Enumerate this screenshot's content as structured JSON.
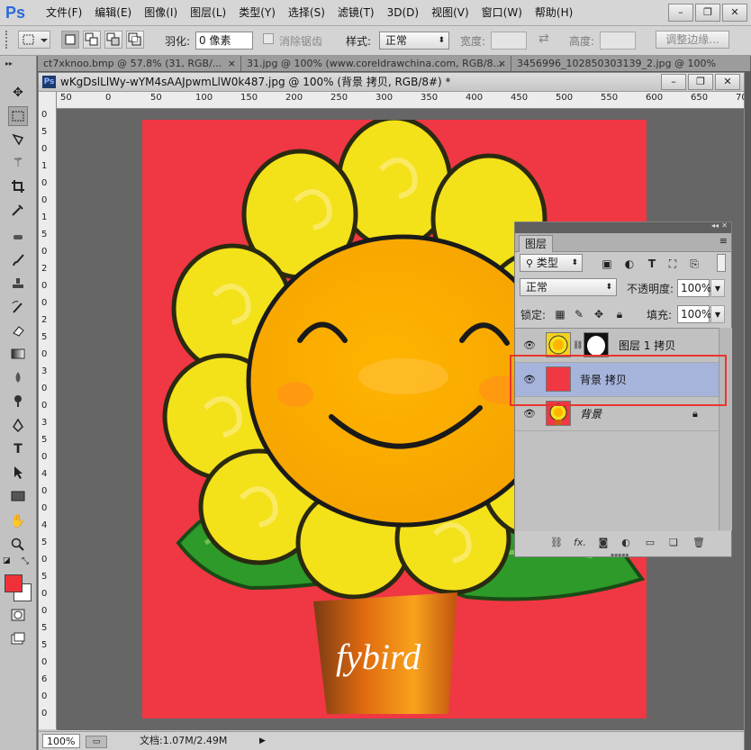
{
  "app": {
    "logo": "Ps"
  },
  "menu": [
    "文件(F)",
    "编辑(E)",
    "图像(I)",
    "图层(L)",
    "类型(Y)",
    "选择(S)",
    "滤镜(T)",
    "3D(D)",
    "视图(V)",
    "窗口(W)",
    "帮助(H)"
  ],
  "window_controls": {
    "minimize": "–",
    "restore": "❐",
    "close": "✕"
  },
  "options": {
    "feather_label": "羽化:",
    "feather_value": "0 像素",
    "antialias_label": "消除锯齿",
    "style_label": "样式:",
    "style_value": "正常",
    "width_label": "宽度:",
    "height_label": "高度:",
    "refine_edge": "调整边缘..."
  },
  "doc_tabs": [
    "ct7xknoo.bmp @ 57.8% (31, RGB/...",
    "31.jpg @ 100% (www.coreldrawchina.com, RGB/8...",
    "3456996_102850303139_2.jpg @ 100%"
  ],
  "document": {
    "title": "wKgDslLlWy-wYM4sAAJpwmLlW0k487.jpg @ 100% (背景 拷贝, RGB/8#) *",
    "hruler": [
      "100",
      "50",
      "0",
      "50",
      "100",
      "150",
      "200",
      "250",
      "300",
      "350",
      "400",
      "450",
      "500",
      "550",
      "600",
      "650",
      "700",
      "750"
    ],
    "vruler": [
      "0",
      "5",
      "0",
      "1",
      "0",
      "0",
      "1",
      "5",
      "0",
      "2",
      "0",
      "0",
      "2",
      "5",
      "0",
      "3",
      "0",
      "0",
      "3",
      "5",
      "0",
      "4",
      "0",
      "0",
      "4",
      "5",
      "0",
      "5",
      "0",
      "0",
      "5",
      "5",
      "0",
      "6",
      "0",
      "0"
    ],
    "zoom": "100%",
    "doc_info": "文档:1.07M/2.49M",
    "artwork_text": "fybird"
  },
  "layers_panel": {
    "tab": "图层",
    "filter_label": "类型",
    "blend_mode": "正常",
    "opacity_label": "不透明度:",
    "opacity_value": "100%",
    "lock_label": "锁定:",
    "fill_label": "填充:",
    "fill_value": "100%",
    "layers": [
      {
        "name": "图层 1 拷贝",
        "selected": false
      },
      {
        "name": "背景 拷贝",
        "selected": true
      },
      {
        "name": "背景",
        "selected": false,
        "locked": true
      }
    ]
  },
  "colors": {
    "foreground": "#f03038",
    "background": "#ffffff",
    "canvas_bg": "#f03744",
    "selection_row": "#a6b4dc",
    "highlight_box": "#e8362e"
  }
}
